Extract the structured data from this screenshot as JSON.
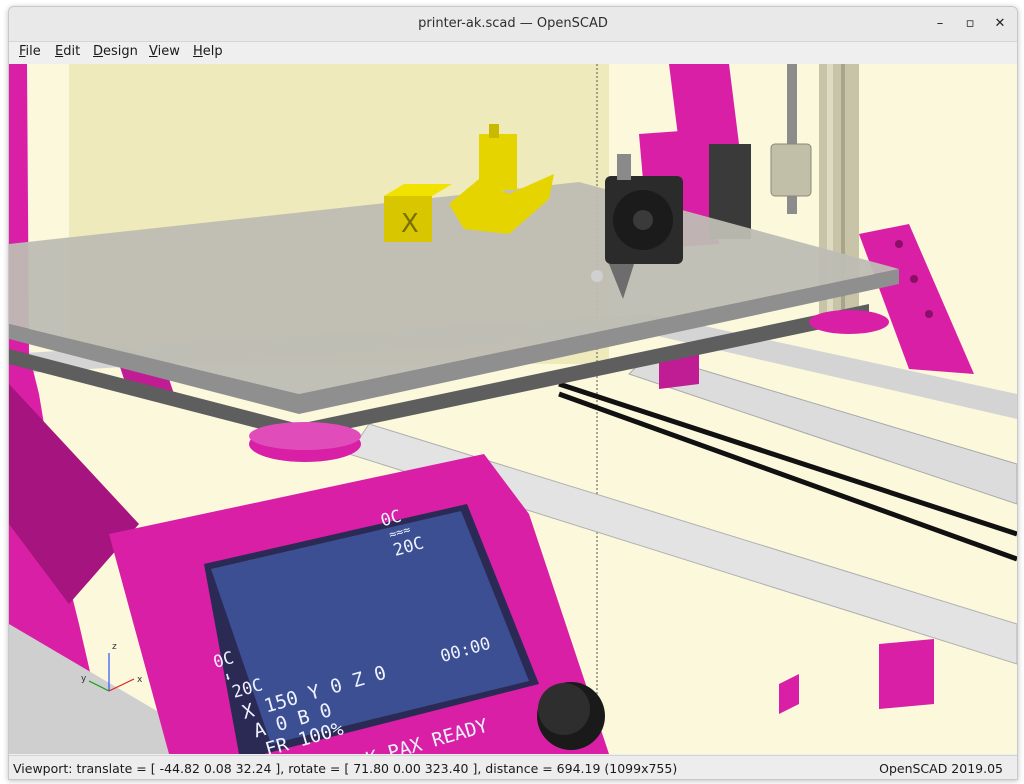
{
  "window": {
    "title": "printer-ak.scad — OpenSCAD",
    "minimize_glyph": "–",
    "maximize_glyph": "▫",
    "close_glyph": "✕"
  },
  "menu": {
    "items": [
      {
        "label": "File",
        "mnemonic": "F",
        "rest": "ile"
      },
      {
        "label": "Edit",
        "mnemonic": "E",
        "rest": "dit"
      },
      {
        "label": "Design",
        "mnemonic": "D",
        "rest": "esign"
      },
      {
        "label": "View",
        "mnemonic": "V",
        "rest": "iew"
      },
      {
        "label": "Help",
        "mnemonic": "H",
        "rest": "elp"
      }
    ]
  },
  "viewport": {
    "background_color": "#fbf8dc",
    "frame_color": "#d81fa5",
    "axes": {
      "x": "x",
      "y": "y",
      "z": "z"
    },
    "lcd": {
      "bed_target": "0C",
      "bed_current": "20C",
      "hotend_target": "0C",
      "hotend_current": "20C",
      "position": "X 150  Y 0  Z 0",
      "time": "00:00",
      "extruders": "A 0 B 0",
      "feedrate": "FR 100%",
      "status": "ASHTAR K PAX READY"
    }
  },
  "statusbar": {
    "viewport_info": "Viewport: translate = [ -44.82 0.08 32.24 ], rotate = [ 71.80 0.00 323.40 ], distance = 694.19 (1099x755)",
    "version": "OpenSCAD 2019.05"
  }
}
